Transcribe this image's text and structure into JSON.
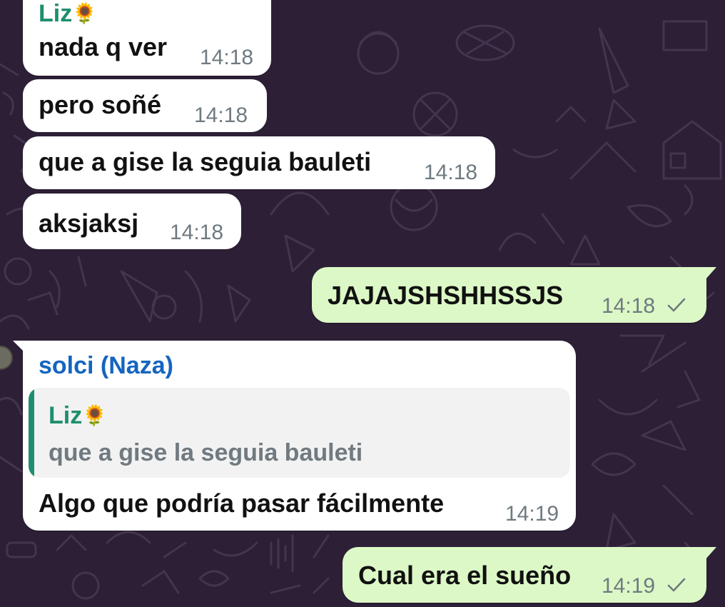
{
  "theme": {
    "background": "#2c1f36",
    "incoming_bubble": "#ffffff",
    "outgoing_bubble": "#dcf8c6",
    "sender_liz_color": "#1e8e6e",
    "sender_solci_color": "#1565c0",
    "timestamp_color": "#6f7a80"
  },
  "messages": [
    {
      "sender": "Liz",
      "sender_emoji": "🌻",
      "text": "nada q ver",
      "time": "14:18"
    },
    {
      "text": "pero soñé",
      "time": "14:18"
    },
    {
      "text": "que a gise la seguia bauleti",
      "time": "14:18"
    },
    {
      "text": "aksjaksj",
      "time": "14:18"
    },
    {
      "text": "JAJAJSHSHHSSJS",
      "time": "14:18",
      "status_icon": "single-check-icon"
    },
    {
      "sender": "solci (Naza)",
      "quote": {
        "sender": "Liz",
        "sender_emoji": "🌻",
        "text": "que a gise la seguia bauleti"
      },
      "text": "Algo que podría pasar fácilmente",
      "time": "14:19"
    },
    {
      "text": "Cual era el sueño",
      "time": "14:19",
      "status_icon": "single-check-icon"
    }
  ]
}
